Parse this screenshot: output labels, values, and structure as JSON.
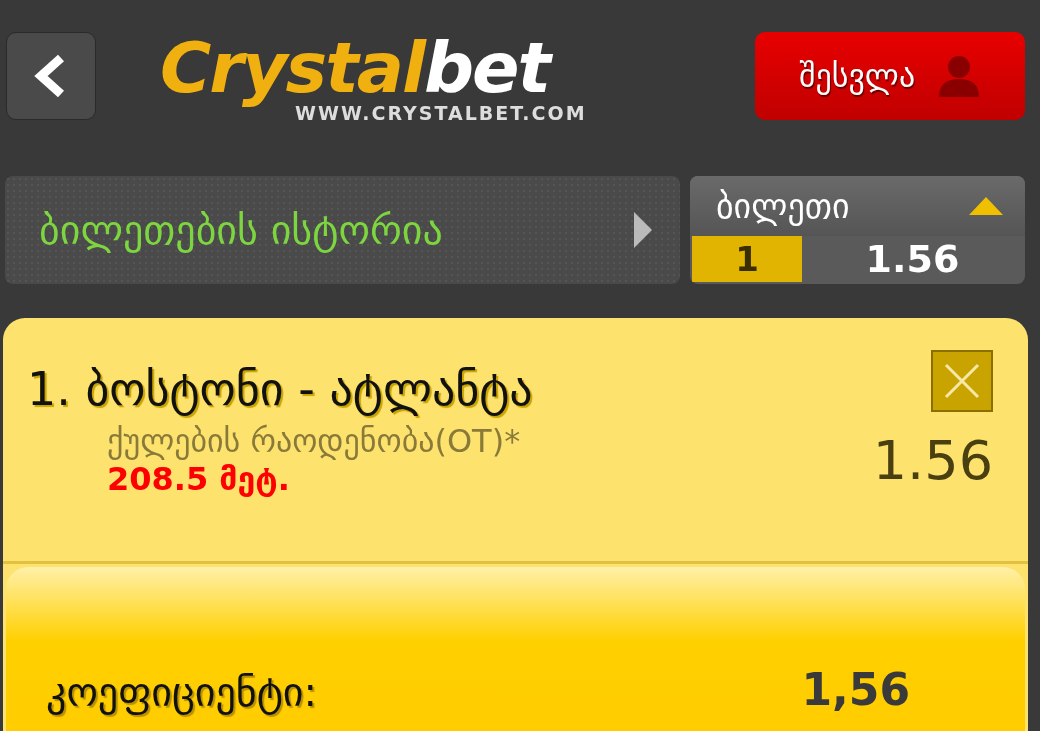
{
  "header": {
    "logo": {
      "word_1": "Crystal",
      "word_2": "bet",
      "url": "WWW.CRYSTALBET.COM"
    },
    "login_button": {
      "label": "შესვლა"
    }
  },
  "history_link": {
    "label": "ბილეთების ისტორია"
  },
  "ticket": {
    "label": "ბილეთი",
    "expanded": true,
    "count": "1",
    "odds": "1.56"
  },
  "bets": [
    {
      "title": "1. ბოსტონი - ატლანტა",
      "market": "ქულების რაოდენობა(OT)*",
      "pick": "208.5 მეტ.",
      "odds": "1.56"
    }
  ],
  "total": {
    "label": "კოეფიციენტი:",
    "value": "1,56"
  }
}
